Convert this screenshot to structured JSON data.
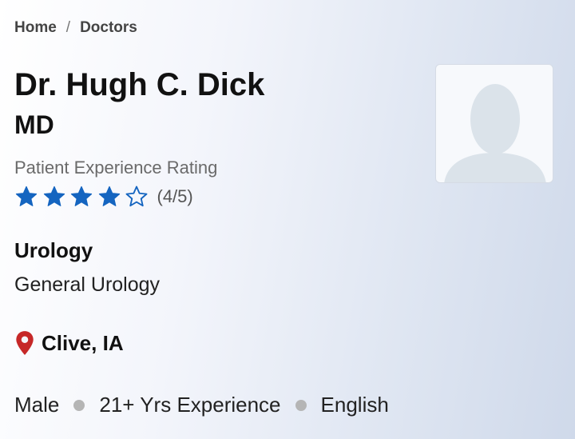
{
  "breadcrumb": {
    "home": "Home",
    "separator": "/",
    "current": "Doctors"
  },
  "doctor": {
    "name": "Dr. Hugh C. Dick",
    "credentials": "MD",
    "rating_label": "Patient Experience Rating",
    "rating_value": 4,
    "rating_max": 5,
    "rating_text": "(4/5)",
    "specialty": "Urology",
    "subspecialty": "General Urology",
    "location": "Clive, IA",
    "gender": "Male",
    "experience": "21+ Yrs Experience",
    "language": "English"
  },
  "icons": {
    "star_filled": "star-filled-icon",
    "star_empty": "star-outline-icon",
    "location": "map-pin-icon",
    "avatar": "person-silhouette"
  },
  "colors": {
    "star": "#1565c0",
    "pin": "#c62828",
    "dot": "#b5b5b5"
  }
}
